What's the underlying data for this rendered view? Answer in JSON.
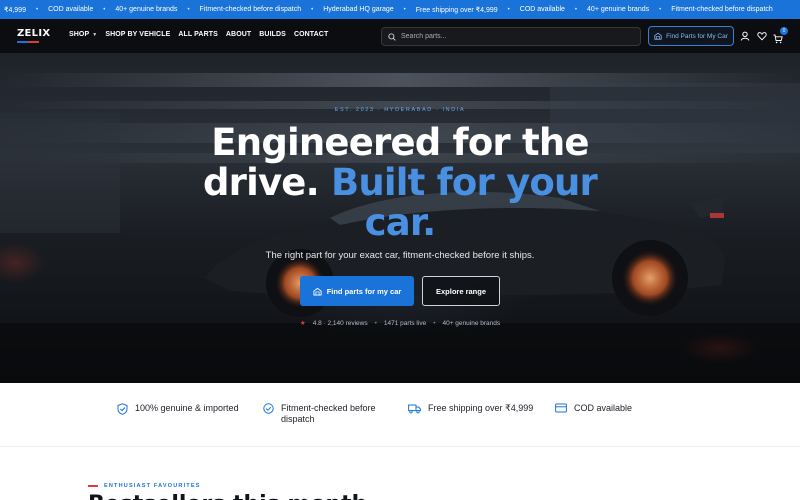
{
  "ticker": {
    "items": [
      "₹4,999",
      "COD available",
      "40+ genuine brands",
      "Fitment-checked before dispatch",
      "Hyderabad HQ garage",
      "Free shipping over ₹4,999",
      "COD available",
      "40+ genuine brands",
      "Fitment-checked before dispatch"
    ]
  },
  "header": {
    "logo": "ZELIX",
    "nav": [
      "SHOP",
      "SHOP BY VEHICLE",
      "ALL PARTS",
      "ABOUT",
      "BUILDS",
      "CONTACT"
    ],
    "search_placeholder": "Search parts...",
    "find_parts_label": "Find Parts for My Car",
    "cart_count": "0",
    "icons": [
      "search-icon",
      "garage-icon",
      "user-icon",
      "heart-icon",
      "cart-icon"
    ]
  },
  "hero": {
    "eyebrow": "EST. 2023 · HYDERABAD · INDIA",
    "headline_white": "Engineered for the drive.",
    "headline_accent": "Built for your car.",
    "subtitle": "The right part for your exact car, fitment-checked before it ships.",
    "cta_primary": "Find parts for my car",
    "cta_secondary": "Explore range",
    "rating": "4.8 · 2,140 reviews",
    "parts_live": "1471 parts live",
    "brands": "40+ genuine brands"
  },
  "features": [
    {
      "icon": "shield-check-icon",
      "label": "100% genuine & imported"
    },
    {
      "icon": "check-circle-icon",
      "label": "Fitment-checked before dispatch"
    },
    {
      "icon": "truck-icon",
      "label": "Free shipping over ₹4,999"
    },
    {
      "icon": "card-icon",
      "label": "COD available"
    }
  ],
  "section": {
    "eyebrow": "ENTHUSIAST FAVOURITES",
    "title": "Bestsellers this month"
  },
  "colors": {
    "brand_blue": "#1a73d9",
    "accent_red": "#e23a3a",
    "header_bg": "#0b0d11"
  }
}
